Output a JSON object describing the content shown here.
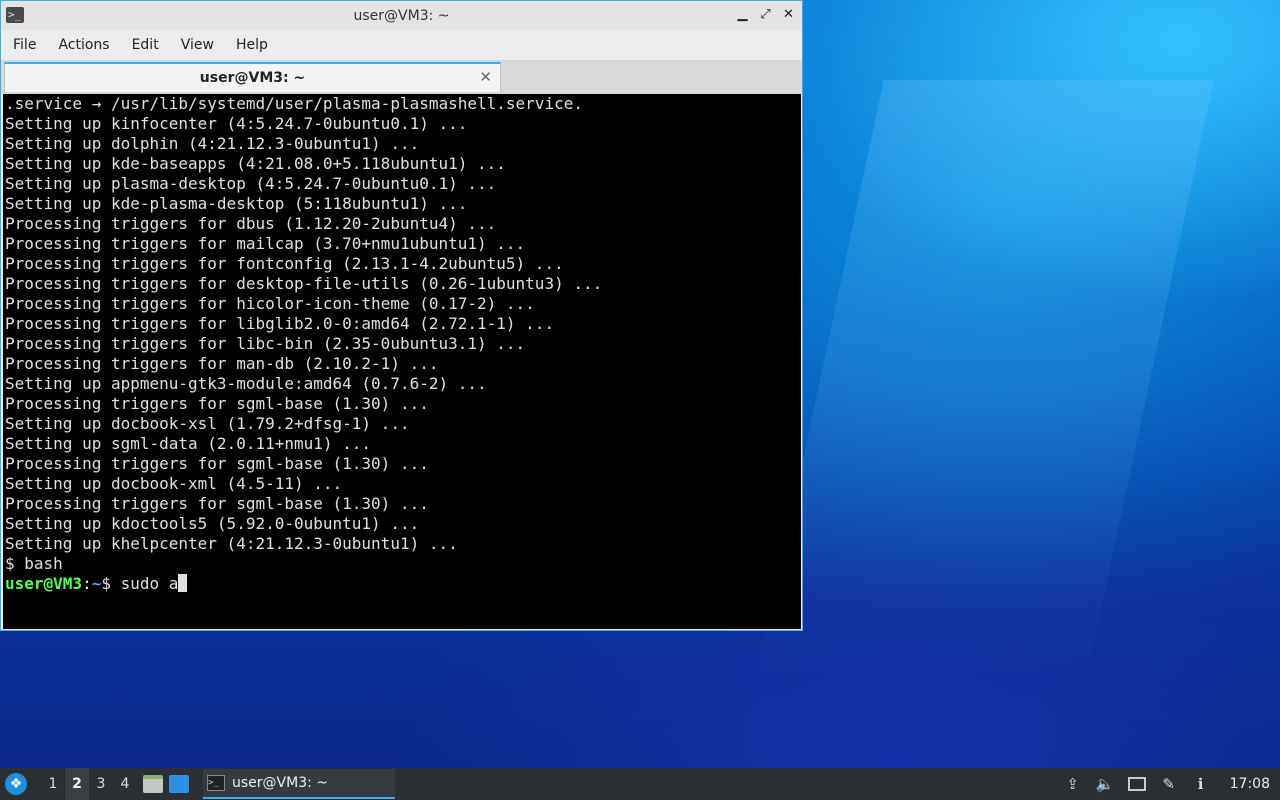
{
  "window": {
    "title": "user@VM3: ~",
    "icon": "terminal-icon",
    "controls": {
      "minimize": "▁",
      "maximize": "⤢",
      "close": "✕"
    }
  },
  "menubar": [
    "File",
    "Actions",
    "Edit",
    "View",
    "Help"
  ],
  "tab": {
    "label": "user@VM3: ~",
    "close": "✕"
  },
  "terminal": {
    "lines": [
      ".service → /usr/lib/systemd/user/plasma-plasmashell.service.",
      "Setting up kinfocenter (4:5.24.7-0ubuntu0.1) ...",
      "Setting up dolphin (4:21.12.3-0ubuntu1) ...",
      "Setting up kde-baseapps (4:21.08.0+5.118ubuntu1) ...",
      "Setting up plasma-desktop (4:5.24.7-0ubuntu0.1) ...",
      "Setting up kde-plasma-desktop (5:118ubuntu1) ...",
      "Processing triggers for dbus (1.12.20-2ubuntu4) ...",
      "Processing triggers for mailcap (3.70+nmu1ubuntu1) ...",
      "Processing triggers for fontconfig (2.13.1-4.2ubuntu5) ...",
      "Processing triggers for desktop-file-utils (0.26-1ubuntu3) ...",
      "Processing triggers for hicolor-icon-theme (0.17-2) ...",
      "Processing triggers for libglib2.0-0:amd64 (2.72.1-1) ...",
      "Processing triggers for libc-bin (2.35-0ubuntu3.1) ...",
      "Processing triggers for man-db (2.10.2-1) ...",
      "Setting up appmenu-gtk3-module:amd64 (0.7.6-2) ...",
      "Processing triggers for sgml-base (1.30) ...",
      "Setting up docbook-xsl (1.79.2+dfsg-1) ...",
      "Setting up sgml-data (2.0.11+nmu1) ...",
      "Processing triggers for sgml-base (1.30) ...",
      "Setting up docbook-xml (4.5-11) ...",
      "Processing triggers for sgml-base (1.30) ...",
      "Setting up kdoctools5 (5.92.0-0ubuntu1) ...",
      "Setting up khelpcenter (4:21.12.3-0ubuntu1) ...",
      "$ bash"
    ],
    "prompt": {
      "user": "user@VM3",
      "sep": ":",
      "path": "~",
      "symbol": "$ ",
      "input": "sudo a"
    }
  },
  "taskbar": {
    "start_icon": "start-menu-icon",
    "start_glyph": "❖",
    "workspaces": [
      "1",
      "2",
      "3",
      "4"
    ],
    "active_workspace": "2",
    "launchers": [
      "file-manager-icon",
      "show-desktop-icon"
    ],
    "task": {
      "label": "user@VM3: ~",
      "icon_glyph": ">_"
    },
    "tray": {
      "upload": "⇪",
      "volume": "🔈",
      "notes": "✎",
      "info": "ℹ"
    },
    "clock": "17:08"
  },
  "colors": {
    "accent": "#3daee9",
    "terminal_bg": "#000000",
    "prompt_user": "#55ff55",
    "prompt_path": "#5c9cff"
  }
}
